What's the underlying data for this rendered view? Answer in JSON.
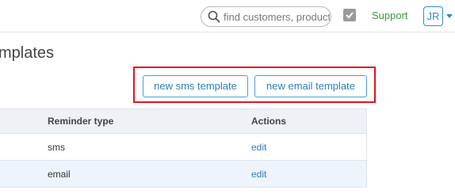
{
  "header": {
    "search_placeholder": "find customers, products",
    "support_label": "Support",
    "avatar_initials": "JR"
  },
  "page": {
    "title": "Templates",
    "visible_title": "mplates"
  },
  "actions": {
    "new_sms_label": "new sms template",
    "new_email_label": "new email template"
  },
  "table": {
    "columns": [
      "Reminder type",
      "Actions"
    ],
    "rows": [
      {
        "type": "sms",
        "action": "edit"
      },
      {
        "type": "email",
        "action": "edit"
      }
    ]
  },
  "colors": {
    "accent": "#2e7fb8",
    "support": "#3a9a3a",
    "highlight": "#e0141e"
  }
}
